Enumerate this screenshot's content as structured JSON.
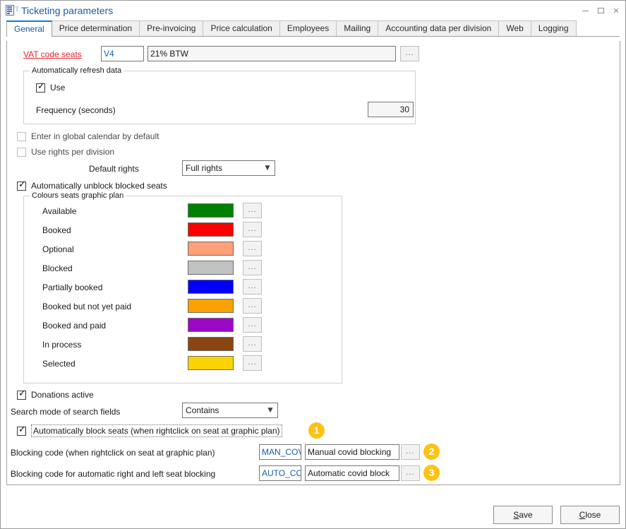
{
  "window": {
    "title": "Ticketing parameters",
    "icon": "form-document-icon",
    "minimize_label": "Minimize",
    "maximize_label": "Maximize",
    "close_label": "Close"
  },
  "tabs": [
    {
      "label": "General",
      "active": true
    },
    {
      "label": "Price determination",
      "active": false
    },
    {
      "label": "Pre-invoicing",
      "active": false
    },
    {
      "label": "Price calculation",
      "active": false
    },
    {
      "label": "Employees",
      "active": false
    },
    {
      "label": "Mailing",
      "active": false
    },
    {
      "label": "Accounting data per division",
      "active": false
    },
    {
      "label": "Web",
      "active": false
    },
    {
      "label": "Logging",
      "active": false
    }
  ],
  "vat": {
    "label": "VAT code seats",
    "code": "V4",
    "description": "21% BTW",
    "browse_label": "..."
  },
  "refresh_group": {
    "title": "Automatically refresh data",
    "use_label": "Use",
    "use_checked": true,
    "frequency_label": "Frequency (seconds)",
    "frequency_value": "30"
  },
  "options": {
    "global_calendar_label": "Enter in global calendar by default",
    "global_calendar_checked": false,
    "rights_per_division_label": "Use rights per division",
    "rights_per_division_checked": false,
    "default_rights_label": "Default rights",
    "default_rights_value": "Full rights",
    "auto_unblock_label": "Automatically unblock blocked seats",
    "auto_unblock_checked": true
  },
  "colours_group": {
    "title": "Colours seats graphic plan",
    "browse_label": "...",
    "rows": [
      {
        "label": "Available",
        "color": "#008000"
      },
      {
        "label": "Booked",
        "color": "#fa0000"
      },
      {
        "label": "Optional",
        "color": "#fd9f79"
      },
      {
        "label": "Blocked",
        "color": "#c2c2c2"
      },
      {
        "label": "Partially booked",
        "color": "#0000f5"
      },
      {
        "label": "Booked but not yet paid",
        "color": "#fba100"
      },
      {
        "label": "Booked and paid",
        "color": "#9c09c6"
      },
      {
        "label": "In process",
        "color": "#8a4513"
      },
      {
        "label": "Selected",
        "color": "#fbd400"
      }
    ]
  },
  "bottom": {
    "donations_label": "Donations active",
    "donations_checked": true,
    "search_mode_label": "Search mode of search fields",
    "search_mode_value": "Contains",
    "auto_block_label": "Automatically block seats (when rightclick on seat at graphic plan)",
    "auto_block_checked": true,
    "manual_block": {
      "label": "Blocking code (when rightclick on seat at graphic plan)",
      "code": "MAN_COV",
      "description": "Manual covid blocking",
      "browse_label": "..."
    },
    "auto_block_code": {
      "label": "Blocking code for automatic right and left seat blocking",
      "code": "AUTO_CO",
      "description": "Automatic covid block",
      "browse_label": "..."
    }
  },
  "badges": [
    {
      "number": "1"
    },
    {
      "number": "2"
    },
    {
      "number": "3"
    }
  ],
  "footer": {
    "save_label": "Save",
    "save_accel": "S",
    "save_rest": "ave",
    "close_label": "Close",
    "close_accel": "C",
    "close_rest": "lose"
  }
}
